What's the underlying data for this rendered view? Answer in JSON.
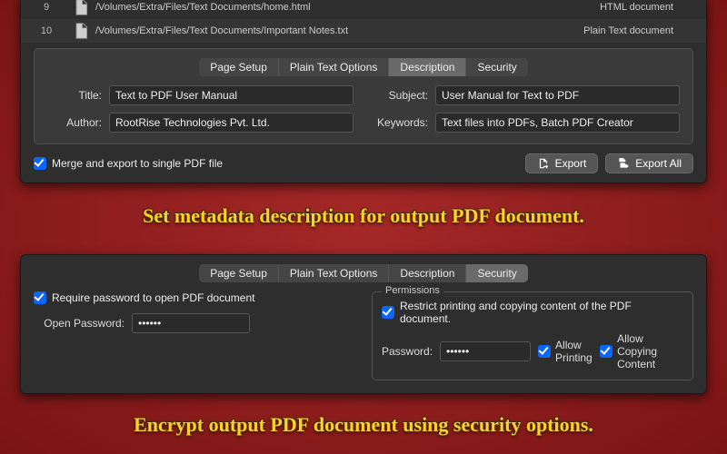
{
  "files": [
    {
      "idx": "9",
      "path": "/Volumes/Extra/Files/Text Documents/home.html",
      "kind": "HTML document"
    },
    {
      "idx": "10",
      "path": "/Volumes/Extra/Files/Text Documents/Important Notes.txt",
      "kind": "Plain Text document"
    }
  ],
  "tabs_top": {
    "page_setup": "Page Setup",
    "plain_text": "Plain Text Options",
    "description": "Description",
    "security": "Security"
  },
  "desc": {
    "title_label": "Title:",
    "author_label": "Author:",
    "subject_label": "Subject:",
    "keywords_label": "Keywords:",
    "title": "Text to PDF User Manual",
    "author": "RootRise Technologies Pvt. Ltd.",
    "subject": "User Manual for Text to PDF",
    "keywords": "Text files into PDFs, Batch PDF Creator"
  },
  "footer": {
    "merge": "Merge and export to single PDF file",
    "export": "Export",
    "export_all": "Export All"
  },
  "promo1": "Set metadata description for output PDF document.",
  "promo2": "Encrypt output PDF document using security options.",
  "sec": {
    "require": "Require password to open PDF document",
    "open_pw_label": "Open Password:",
    "open_pw_value": "••••••",
    "perm_legend": "Permissions",
    "restrict": "Restrict printing and copying content of the PDF document.",
    "pw_label": "Password:",
    "pw_value": "••••••",
    "allow_print": "Allow Printing",
    "allow_copy": "Allow Copying Content"
  }
}
